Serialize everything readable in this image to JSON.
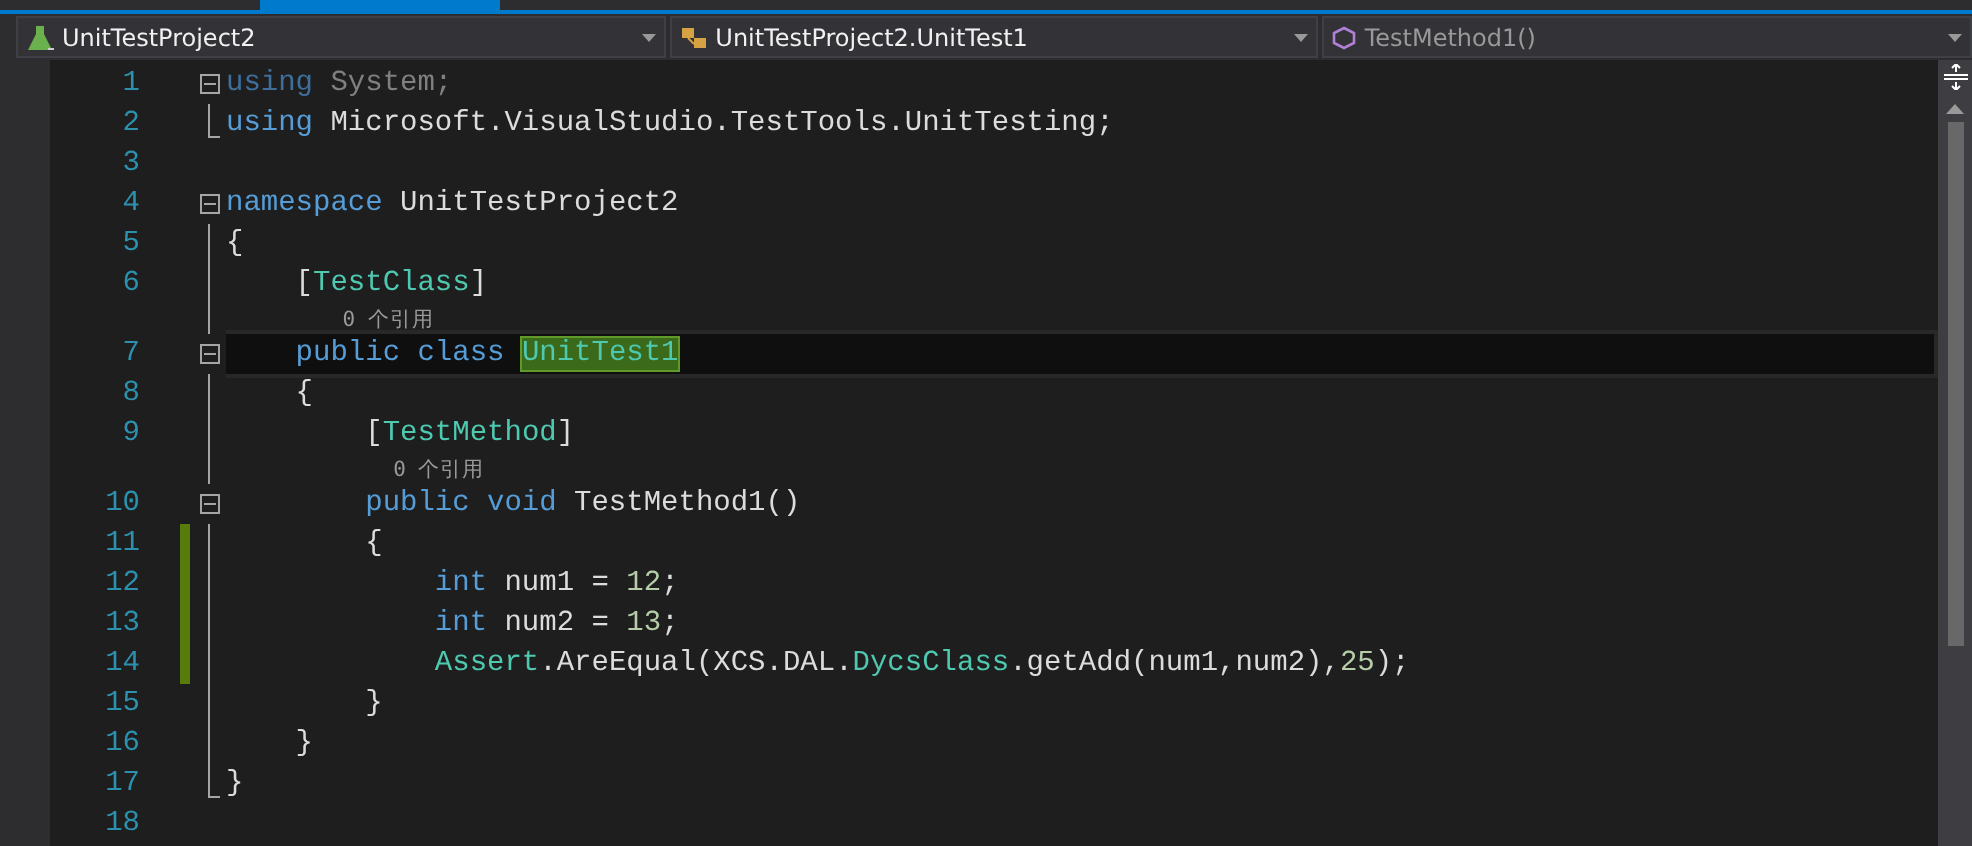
{
  "navigation_bar": {
    "dropdowns": [
      {
        "kind": "project",
        "label": "UnitTestProject2"
      },
      {
        "kind": "class",
        "label": "UnitTestProject2.UnitTest1"
      },
      {
        "kind": "method",
        "label": "TestMethod1()"
      }
    ]
  },
  "editor": {
    "lines": [
      {
        "kind": "code",
        "number": "1",
        "fold": {
          "kind": "collapse"
        },
        "changed": false,
        "current": false,
        "tokens": [
          {
            "kind": "dimkeyword",
            "text": "using"
          },
          {
            "kind": "dim",
            "text": " System;"
          }
        ]
      },
      {
        "kind": "code",
        "number": "2",
        "fold": {
          "kind": "end"
        },
        "changed": false,
        "current": false,
        "tokens": [
          {
            "kind": "keyword",
            "text": "using"
          },
          {
            "kind": "plain",
            "text": " Microsoft.VisualStudio.TestTools.UnitTesting;"
          }
        ]
      },
      {
        "kind": "code",
        "number": "3",
        "changed": false,
        "current": false
      },
      {
        "kind": "code",
        "number": "4",
        "fold": {
          "kind": "collapse"
        },
        "changed": false,
        "current": false,
        "tokens": [
          {
            "kind": "keyword",
            "text": "namespace"
          },
          {
            "kind": "plain",
            "text": " UnitTestProject2"
          }
        ]
      },
      {
        "kind": "code",
        "number": "5",
        "fold": {
          "kind": "line"
        },
        "changed": false,
        "current": false,
        "tokens": [
          {
            "kind": "plain",
            "text": "{"
          }
        ]
      },
      {
        "kind": "code",
        "number": "6",
        "fold": {
          "kind": "line"
        },
        "changed": false,
        "current": false,
        "tokens": [
          {
            "kind": "plain",
            "text": "    ["
          },
          {
            "kind": "type",
            "text": "TestClass"
          },
          {
            "kind": "plain",
            "text": "]"
          }
        ]
      },
      {
        "kind": "codelens",
        "text": "    0 个引用"
      },
      {
        "kind": "code",
        "number": "7",
        "fold": {
          "kind": "collapse"
        },
        "changed": false,
        "current": true,
        "tokens": [
          {
            "kind": "keyword",
            "text": "    public class "
          },
          {
            "kind": "highlight",
            "text": "UnitTest1"
          }
        ]
      },
      {
        "kind": "code",
        "number": "8",
        "fold": {
          "kind": "line"
        },
        "changed": false,
        "current": false,
        "tokens": [
          {
            "kind": "plain",
            "text": "    {"
          }
        ]
      },
      {
        "kind": "code",
        "number": "9",
        "fold": {
          "kind": "line"
        },
        "changed": false,
        "current": false,
        "tokens": [
          {
            "kind": "plain",
            "text": "        ["
          },
          {
            "kind": "type",
            "text": "TestMethod"
          },
          {
            "kind": "plain",
            "text": "]"
          }
        ]
      },
      {
        "kind": "codelens",
        "text": "        0 个引用"
      },
      {
        "kind": "code",
        "number": "10",
        "fold": {
          "kind": "collapse"
        },
        "changed": false,
        "current": false,
        "tokens": [
          {
            "kind": "keyword",
            "text": "        public void"
          },
          {
            "kind": "plain",
            "text": " TestMethod1()"
          }
        ]
      },
      {
        "kind": "code",
        "number": "11",
        "fold": {
          "kind": "line"
        },
        "changed": true,
        "current": false,
        "tokens": [
          {
            "kind": "plain",
            "text": "        {"
          }
        ]
      },
      {
        "kind": "code",
        "number": "12",
        "fold": {
          "kind": "line"
        },
        "changed": true,
        "current": false,
        "tokens": [
          {
            "kind": "keyword",
            "text": "            int"
          },
          {
            "kind": "plain",
            "text": " num1 = "
          },
          {
            "kind": "number",
            "text": "12"
          },
          {
            "kind": "plain",
            "text": ";"
          }
        ]
      },
      {
        "kind": "code",
        "number": "13",
        "fold": {
          "kind": "line"
        },
        "changed": true,
        "current": false,
        "tokens": [
          {
            "kind": "keyword",
            "text": "            int"
          },
          {
            "kind": "plain",
            "text": " num2 = "
          },
          {
            "kind": "number",
            "text": "13"
          },
          {
            "kind": "plain",
            "text": ";"
          }
        ]
      },
      {
        "kind": "code",
        "number": "14",
        "fold": {
          "kind": "line"
        },
        "changed": true,
        "current": false,
        "tokens": [
          {
            "kind": "type",
            "text": "            Assert"
          },
          {
            "kind": "plain",
            "text": ".AreEqual(XCS.DAL."
          },
          {
            "kind": "type",
            "text": "DycsClass"
          },
          {
            "kind": "plain",
            "text": ".getAdd(num1,num2),"
          },
          {
            "kind": "number",
            "text": "25"
          },
          {
            "kind": "plain",
            "text": ");"
          }
        ]
      },
      {
        "kind": "code",
        "number": "15",
        "fold": {
          "kind": "line"
        },
        "changed": false,
        "current": false,
        "tokens": [
          {
            "kind": "plain",
            "text": "        }"
          }
        ]
      },
      {
        "kind": "code",
        "number": "16",
        "fold": {
          "kind": "line"
        },
        "changed": false,
        "current": false,
        "tokens": [
          {
            "kind": "plain",
            "text": "    }"
          }
        ]
      },
      {
        "kind": "code",
        "number": "17",
        "fold": {
          "kind": "end"
        },
        "changed": false,
        "current": false,
        "tokens": [
          {
            "kind": "plain",
            "text": "}"
          }
        ]
      },
      {
        "kind": "code",
        "number": "18",
        "changed": false,
        "current": false
      }
    ]
  }
}
